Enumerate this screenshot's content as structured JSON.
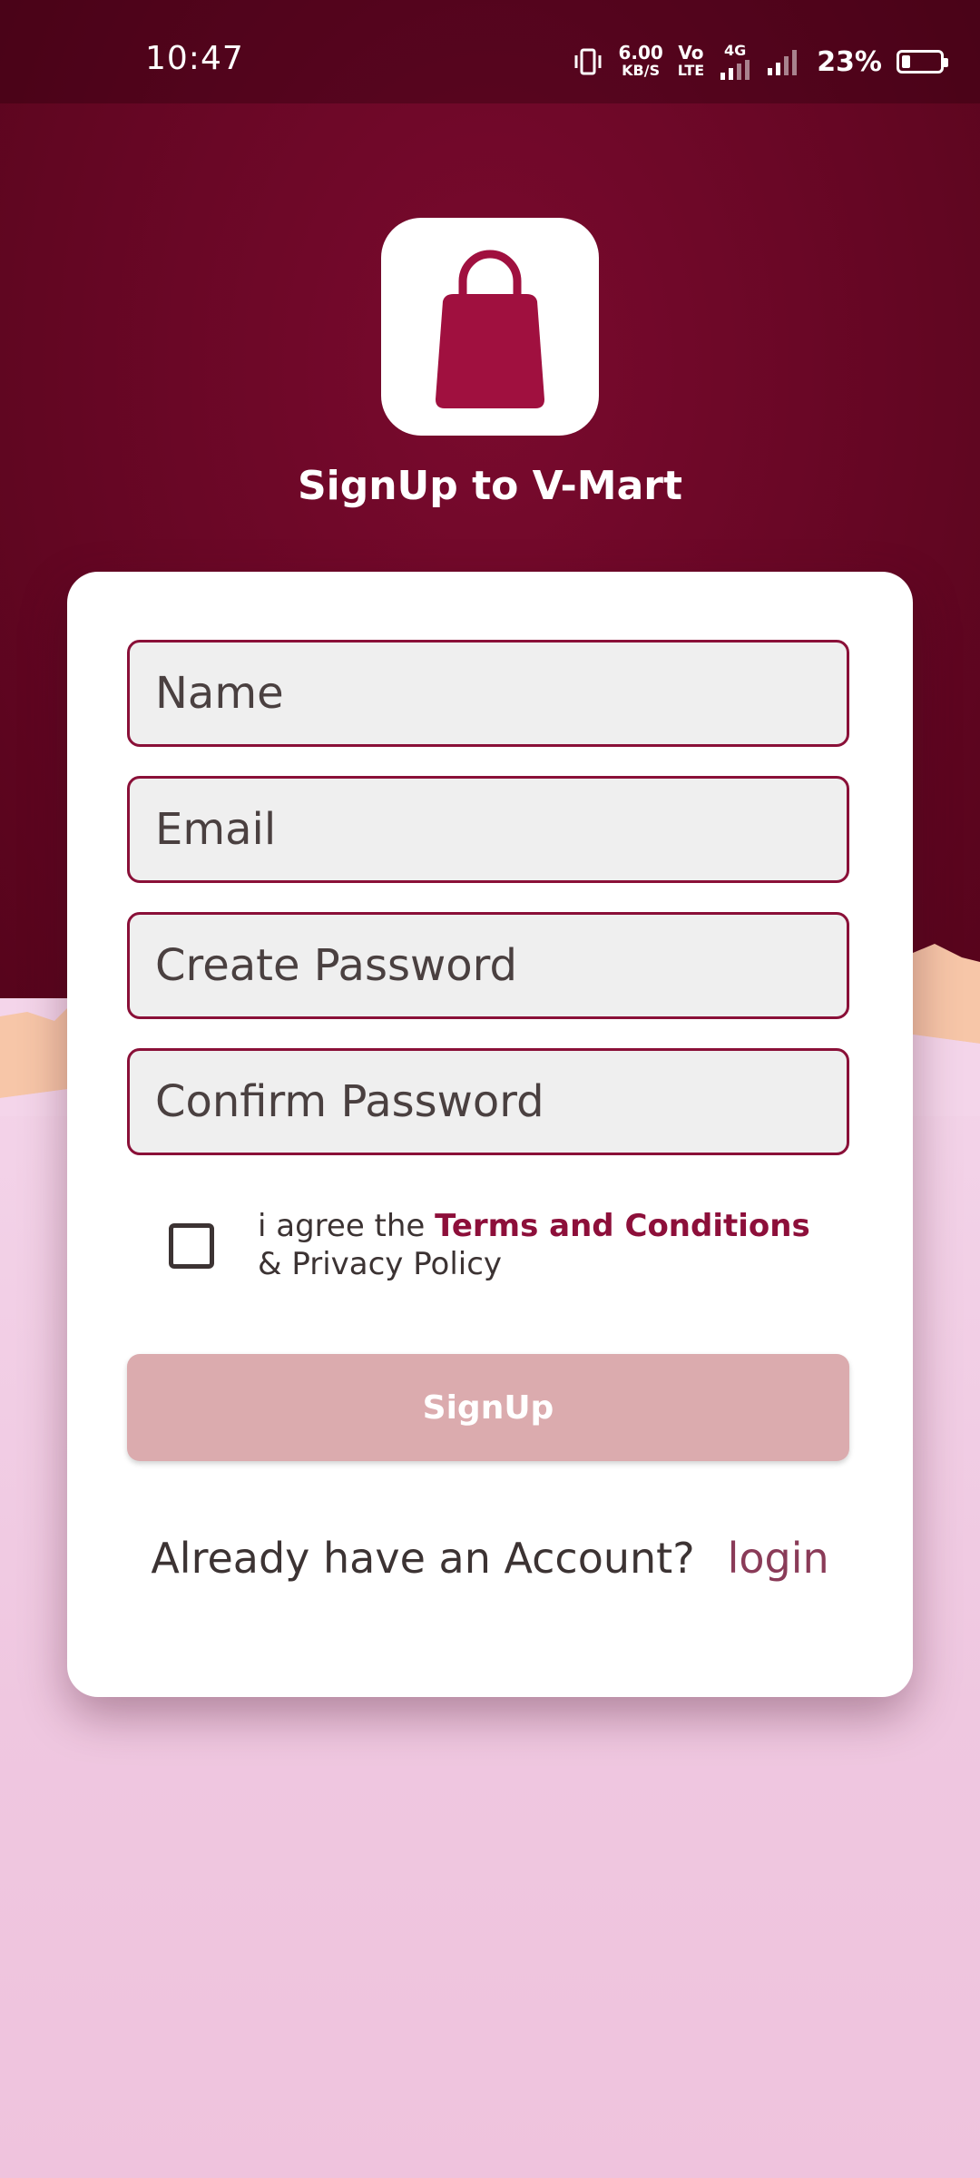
{
  "status_bar": {
    "time": "10:47",
    "net_speed_value": "6.00",
    "net_speed_unit": "KB/S",
    "volte_label_top": "Vo",
    "volte_label_bottom": "LTE",
    "network_type": "4G",
    "battery_percent": "23%",
    "battery_level": 0.23,
    "icons": [
      "vibrate-icon",
      "volte-icon",
      "signal-icon",
      "signal-icon",
      "battery-icon"
    ]
  },
  "header": {
    "logo_icon": "shopping-bag-icon",
    "title": "SignUp to V-Mart"
  },
  "form": {
    "name_placeholder": "Name",
    "email_placeholder": "Email",
    "password_placeholder": "Create Password",
    "confirm_placeholder": "Confirm Password",
    "terms_prefix": "i agree the ",
    "terms_link": "Terms and Conditions",
    "terms_suffix": " & Privacy Policy",
    "terms_checked": false,
    "signup_label": "SignUp",
    "account_question": "Already have an Account?",
    "login_label": "login"
  },
  "colors": {
    "brand": "#8d0f3a",
    "field_border": "#8a1038",
    "button_disabled": "#dbabae",
    "background_top": "#6a0726",
    "background_bottom": "#efc7e0"
  }
}
